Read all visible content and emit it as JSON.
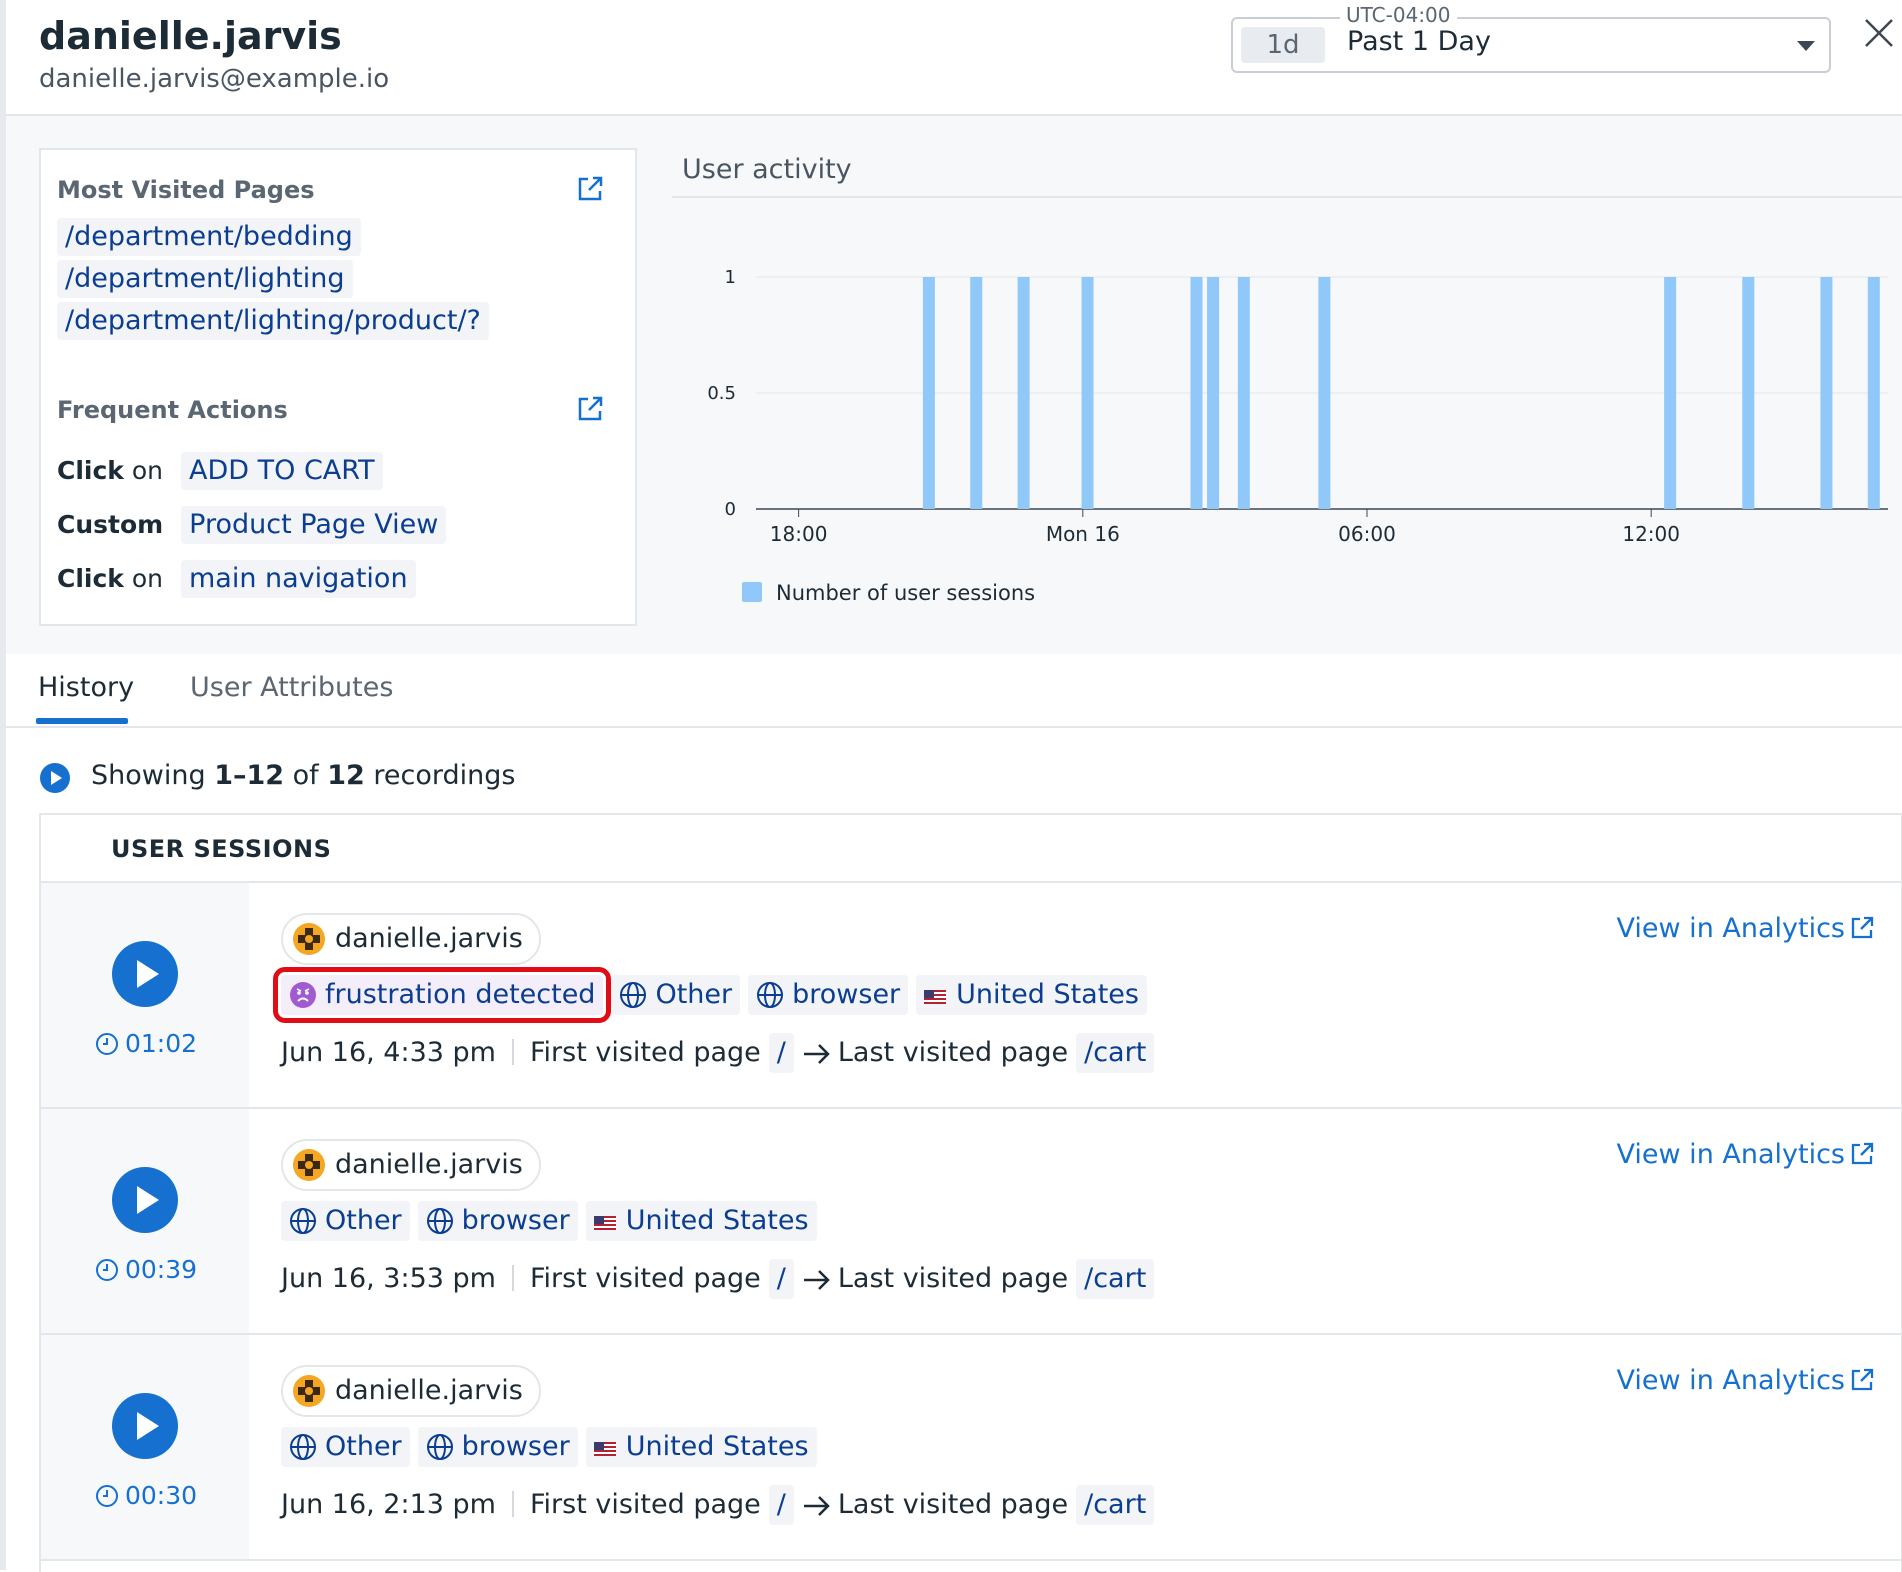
{
  "header": {
    "user_name": "danielle.jarvis",
    "user_email": "danielle.jarvis@example.io",
    "timezone": "UTC-04:00",
    "range_chip": "1d",
    "range_label": "Past 1 Day"
  },
  "summary": {
    "most_visited_title": "Most Visited Pages",
    "pages": [
      "/department/bedding",
      "/department/lighting",
      "/department/lighting/product/?"
    ],
    "frequent_actions_title": "Frequent Actions",
    "actions": [
      {
        "kind": "Click",
        "suffix": " on",
        "target": "ADD TO CART"
      },
      {
        "kind": "Custom",
        "suffix": "",
        "target": "Product Page View"
      },
      {
        "kind": "Click",
        "suffix": " on",
        "target": "main navigation"
      }
    ]
  },
  "activity": {
    "title": "User activity"
  },
  "chart_data": {
    "type": "bar",
    "y_ticks": [
      "0",
      "0.5",
      "1"
    ],
    "ylim": [
      0,
      1
    ],
    "x_ticks": [
      "18:00",
      "Mon 16",
      "06:00",
      "12:00"
    ],
    "x_tick_hours": [
      0,
      6,
      12,
      18
    ],
    "x_range_hours": [
      -0.9,
      23.0
    ],
    "series": [
      {
        "name": "Number of user sessions",
        "color": "#90c8f9",
        "x_hours": [
          2.75,
          3.75,
          4.75,
          6.1,
          8.4,
          8.75,
          9.4,
          11.1,
          18.4,
          20.05,
          21.7,
          22.7
        ],
        "values": [
          1,
          1,
          1,
          1,
          1,
          1,
          1,
          1,
          1,
          1,
          1,
          1
        ]
      }
    ]
  },
  "tabs": [
    "History",
    "User Attributes"
  ],
  "showing": {
    "prefix": "Showing ",
    "range": "1–12",
    "middle": " of ",
    "total": "12",
    "suffix": " recordings"
  },
  "sessions": {
    "title": "USER SESSIONS",
    "view_label": "View in Analytics",
    "first_label": "First visited page",
    "last_label": "Last visited page",
    "rows": [
      {
        "duration": "01:02",
        "user": "danielle.jarvis",
        "frustration": "frustration detected",
        "device": "Other",
        "client": "browser",
        "country": "United States",
        "time": "Jun 16, 4:33 pm",
        "first_page": "/",
        "last_page": "/cart"
      },
      {
        "duration": "00:39",
        "user": "danielle.jarvis",
        "device": "Other",
        "client": "browser",
        "country": "United States",
        "time": "Jun 16, 3:53 pm",
        "first_page": "/",
        "last_page": "/cart"
      },
      {
        "duration": "00:30",
        "user": "danielle.jarvis",
        "device": "Other",
        "client": "browser",
        "country": "United States",
        "time": "Jun 16, 2:13 pm",
        "first_page": "/",
        "last_page": "/cart"
      }
    ]
  }
}
